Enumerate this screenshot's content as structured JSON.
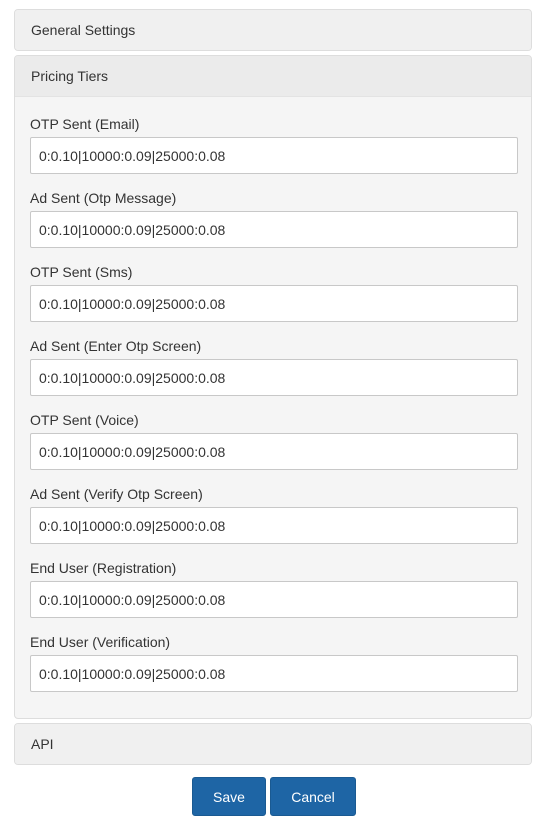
{
  "panels": {
    "general": {
      "title": "General Settings"
    },
    "pricing": {
      "title": "Pricing Tiers",
      "fields": [
        {
          "label": "OTP Sent (Email)",
          "value": "0:0.10|10000:0.09|25000:0.08"
        },
        {
          "label": "Ad Sent (Otp Message)",
          "value": "0:0.10|10000:0.09|25000:0.08"
        },
        {
          "label": "OTP Sent (Sms)",
          "value": "0:0.10|10000:0.09|25000:0.08"
        },
        {
          "label": "Ad Sent (Enter Otp Screen)",
          "value": "0:0.10|10000:0.09|25000:0.08"
        },
        {
          "label": "OTP Sent (Voice)",
          "value": "0:0.10|10000:0.09|25000:0.08"
        },
        {
          "label": "Ad Sent (Verify Otp Screen)",
          "value": "0:0.10|10000:0.09|25000:0.08"
        },
        {
          "label": "End User (Registration)",
          "value": "0:0.10|10000:0.09|25000:0.08"
        },
        {
          "label": "End User (Verification)",
          "value": "0:0.10|10000:0.09|25000:0.08"
        }
      ]
    },
    "api": {
      "title": "API"
    }
  },
  "actions": {
    "save_label": "Save",
    "cancel_label": "Cancel"
  },
  "colors": {
    "primary_button": "#1e65a5",
    "panel_header": "#f0f0f0",
    "panel_border": "#dddddd"
  }
}
